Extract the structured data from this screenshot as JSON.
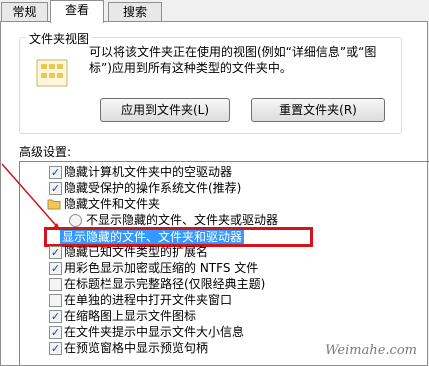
{
  "tabs": [
    {
      "label": "常规"
    },
    {
      "label": "查看"
    },
    {
      "label": "搜索"
    }
  ],
  "folder_views": {
    "title": "文件夹视图",
    "description": "可以将该文件夹正在使用的视图(例如“详细信息”或“图标”)应用到所有这种类型的文件夹中。",
    "apply_button": "应用到文件夹(L)",
    "reset_button": "重置文件夹(R)"
  },
  "advanced": {
    "label": "高级设置:",
    "items": [
      {
        "type": "checkbox",
        "checked": true,
        "label": "隐藏计算机文件夹中的空驱动器"
      },
      {
        "type": "checkbox",
        "checked": true,
        "label": "隐藏受保护的操作系统文件(推荐)"
      },
      {
        "type": "folder",
        "label": "隐藏文件和文件夹"
      },
      {
        "type": "radio",
        "checked": false,
        "label": "不显示隐藏的文件、文件夹或驱动器"
      },
      {
        "type": "radio",
        "checked": true,
        "label": "显示隐藏的文件、文件夹和驱动器"
      },
      {
        "type": "checkbox",
        "checked": true,
        "label": "隐藏已知文件类型的扩展名"
      },
      {
        "type": "checkbox",
        "checked": true,
        "label": "用彩色显示加密或压缩的 NTFS 文件"
      },
      {
        "type": "checkbox",
        "checked": false,
        "label": "在标题栏显示完整路径(仅限经典主题)"
      },
      {
        "type": "checkbox",
        "checked": false,
        "label": "在单独的进程中打开文件夹窗口"
      },
      {
        "type": "checkbox",
        "checked": true,
        "label": "在缩略图上显示文件图标"
      },
      {
        "type": "checkbox",
        "checked": true,
        "label": "在文件夹提示中显示文件大小信息"
      },
      {
        "type": "checkbox",
        "checked": true,
        "label": "在预览窗格中显示预览句柄"
      }
    ]
  },
  "watermark": "Weimahe.com",
  "colors": {
    "highlight": "#3399ff",
    "annotation": "#d4141d"
  }
}
